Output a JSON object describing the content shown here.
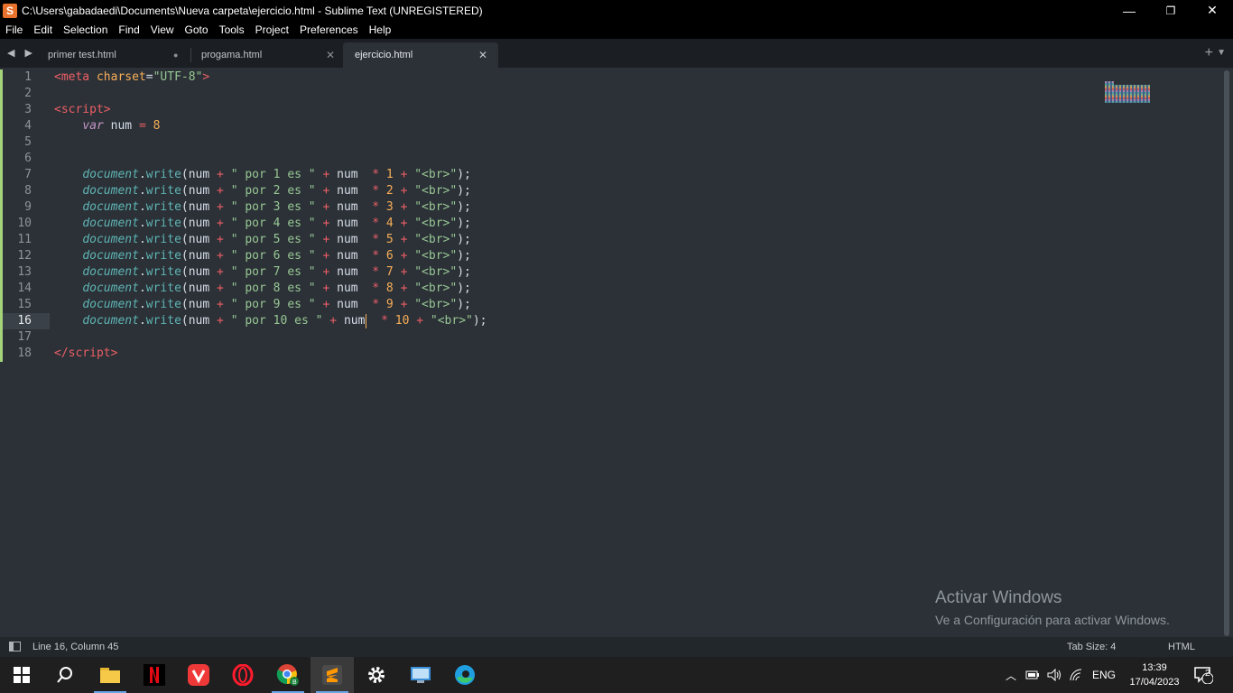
{
  "window": {
    "title": "C:\\Users\\gabadaedi\\Documents\\Nueva carpeta\\ejercicio.html - Sublime Text (UNREGISTERED)",
    "app_icon_letter": "S",
    "min": "—",
    "max": "❐",
    "close": "✕"
  },
  "menu": [
    "File",
    "Edit",
    "Selection",
    "Find",
    "View",
    "Goto",
    "Tools",
    "Project",
    "Preferences",
    "Help"
  ],
  "tabs": {
    "nav": "◀ ▶",
    "items": [
      {
        "label": "primer test.html",
        "marker": "●"
      },
      {
        "label": "progama.html",
        "marker": "✕"
      },
      {
        "label": "ejercicio.html",
        "marker": "✕"
      }
    ],
    "plus": "+",
    "dropdown": "▼"
  },
  "editor": {
    "line_numbers": [
      "1",
      "2",
      "3",
      "4",
      "5",
      "6",
      "7",
      "8",
      "9",
      "10",
      "11",
      "12",
      "13",
      "14",
      "15",
      "16",
      "17",
      "18"
    ],
    "current_line": 16,
    "code": {
      "l1": {
        "open": "<",
        "tag": "meta",
        "attr": " charset",
        "eq": "=",
        "val": "\"UTF-8\"",
        "close": ">"
      },
      "l3": {
        "open": "<",
        "tag": "script",
        "close": ">"
      },
      "l4": {
        "indent": "    ",
        "kw": "var",
        "rest": " num ",
        "op": "=",
        "num": " 8"
      },
      "writes": [
        {
          "n": "1"
        },
        {
          "n": "2"
        },
        {
          "n": "3"
        },
        {
          "n": "4"
        },
        {
          "n": "5"
        },
        {
          "n": "6"
        },
        {
          "n": "7"
        },
        {
          "n": "8"
        },
        {
          "n": "9"
        },
        {
          "n": "10"
        }
      ],
      "w": {
        "indent": "    ",
        "obj": "document",
        "dot": ".",
        "fn": "write",
        "p1": "(num ",
        "plus": "+",
        "s1pre": " \" por ",
        "s1post": " es \" ",
        "num": "num",
        "mul": "*",
        "br": "\"<br>\"",
        "end": ");"
      },
      "l18": {
        "open": "</",
        "tag": "script",
        "close": ">"
      }
    }
  },
  "watermark": {
    "line1": "Activar Windows",
    "line2": "Ve a Configuración para activar Windows."
  },
  "status": {
    "position": "Line 16, Column 45",
    "tab_size": "Tab Size: 4",
    "syntax": "HTML"
  },
  "taskbar": {
    "tray_lang": "ENG",
    "time": "13:39",
    "date": "17/04/2023",
    "notifications": "2"
  },
  "colors": {
    "accent_green": "#a4d37a",
    "tag_red": "#ec5f66",
    "string_green": "#98c794",
    "number_orange": "#f9ae58",
    "keyword_purple": "#c695c6",
    "function_teal": "#5fb4b4"
  }
}
